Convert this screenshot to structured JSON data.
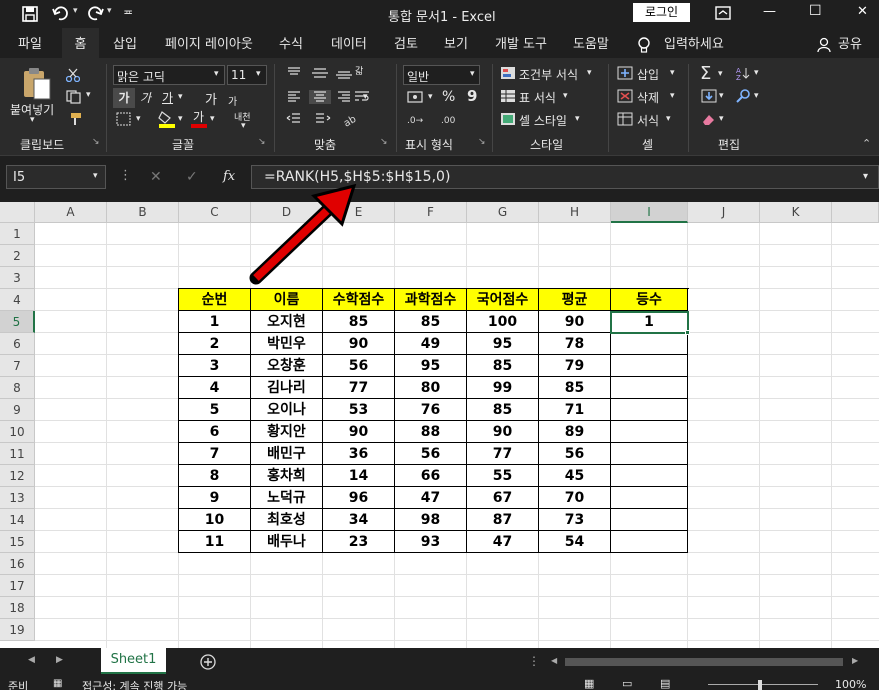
{
  "titlebar": {
    "title": "통합 문서1 - Excel",
    "login_label": "로그인",
    "minimize": "—",
    "maximize": "☐",
    "close": "✕",
    "qat_more": "≖"
  },
  "tabs": [
    "파일",
    "홈",
    "삽입",
    "페이지 레이아웃",
    "수식",
    "데이터",
    "검토",
    "보기",
    "개발 도구",
    "도움말"
  ],
  "tell_me": "입력하세요",
  "share_label": "공유",
  "ribbon": {
    "clipboard": {
      "paste": "붙여넣기",
      "group": "클립보드"
    },
    "font": {
      "name": "맑은 고딕",
      "size": "11",
      "bold": "가",
      "italic": "가",
      "underline": "가",
      "grow": "가",
      "shrink": "가",
      "phonetic": "내천",
      "group": "글꼴"
    },
    "align": {
      "wrap": "갋",
      "group": "맞춤"
    },
    "number": {
      "format": "일반",
      "percent": "%",
      "comma": "9",
      "group": "표시 형식"
    },
    "styles": {
      "conditional": "조건부 서식",
      "table": "표 서식",
      "cell": "셀 스타일",
      "group": "스타일"
    },
    "cells": {
      "insert": "삽입",
      "delete": "삭제",
      "format": "서식",
      "group": "셀"
    },
    "editing": {
      "group": "편집"
    }
  },
  "formula_bar": {
    "name_box": "I5",
    "fx": "fx",
    "formula": "=RANK(H5,$H$5:$H$15,0)"
  },
  "columns": [
    "A",
    "B",
    "C",
    "D",
    "E",
    "F",
    "G",
    "H",
    "I",
    "J",
    "K"
  ],
  "rows": [
    "1",
    "2",
    "3",
    "4",
    "5",
    "6",
    "7",
    "8",
    "9",
    "10",
    "11",
    "12",
    "13",
    "14",
    "15",
    "16",
    "17",
    "18",
    "19"
  ],
  "table": {
    "headers": [
      "순번",
      "이름",
      "수학점수",
      "과학점수",
      "국어점수",
      "평균",
      "등수"
    ],
    "rows": [
      [
        "1",
        "오지현",
        "85",
        "85",
        "100",
        "90",
        "1"
      ],
      [
        "2",
        "박민우",
        "90",
        "49",
        "95",
        "78",
        ""
      ],
      [
        "3",
        "오창훈",
        "56",
        "95",
        "85",
        "79",
        ""
      ],
      [
        "4",
        "김나리",
        "77",
        "80",
        "99",
        "85",
        ""
      ],
      [
        "5",
        "오이나",
        "53",
        "76",
        "85",
        "71",
        ""
      ],
      [
        "6",
        "황지안",
        "90",
        "88",
        "90",
        "89",
        ""
      ],
      [
        "7",
        "배민구",
        "36",
        "56",
        "77",
        "56",
        ""
      ],
      [
        "8",
        "홍차희",
        "14",
        "66",
        "55",
        "45",
        ""
      ],
      [
        "9",
        "노덕규",
        "96",
        "47",
        "67",
        "70",
        ""
      ],
      [
        "10",
        "최호성",
        "34",
        "98",
        "87",
        "73",
        ""
      ],
      [
        "11",
        "배두나",
        "23",
        "93",
        "47",
        "54",
        ""
      ]
    ]
  },
  "sheet_tab": "Sheet1",
  "status": {
    "ready": "준비",
    "accessibility": "접근성: 계속 진행 가능",
    "zoom": "100%"
  },
  "colors": {
    "header_fill": "#ffff00",
    "selection": "#217346",
    "arrow": "#e00000"
  }
}
